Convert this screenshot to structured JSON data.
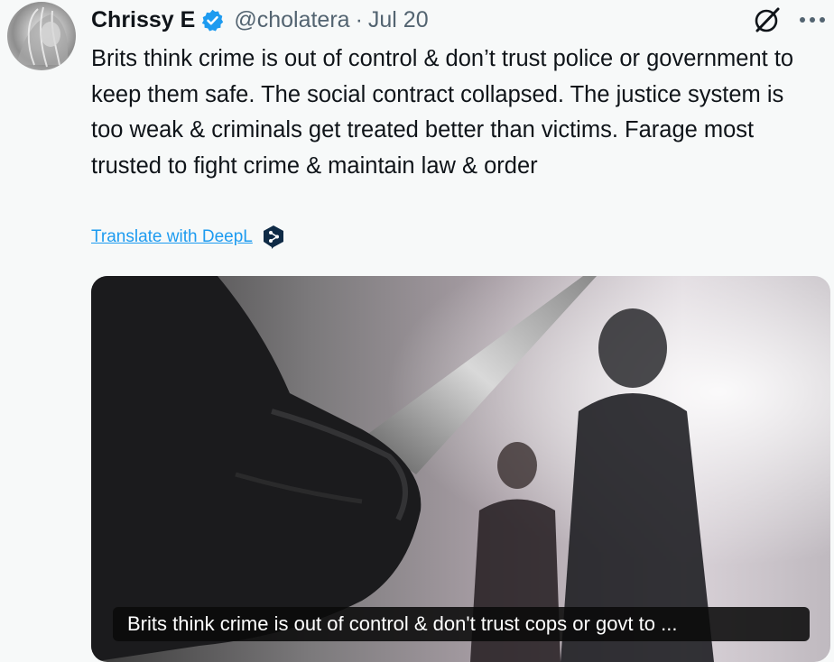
{
  "tweet": {
    "author_name": "Chrissy E",
    "handle": "@cholatera",
    "separator": "·",
    "date": "Jul 20",
    "text": "Brits think crime is out of control & don’t trust police or government to keep them safe. The social contract collapsed. The justice system is too weak & criminals get treated better than victims. Farage most trusted to fight crime & maintain law & order",
    "translate_label": "Translate with DeepL",
    "media_caption": "Brits think crime is out of control & don't trust cops or govt to ..."
  },
  "icons": {
    "verified": "verified-badge-icon",
    "grok": "grok-icon",
    "more": "more-icon",
    "deepl": "deepl-icon"
  },
  "colors": {
    "accent": "#1d9bf0",
    "text": "#0f1419",
    "secondary": "#536471",
    "background": "#f7f9f9"
  }
}
